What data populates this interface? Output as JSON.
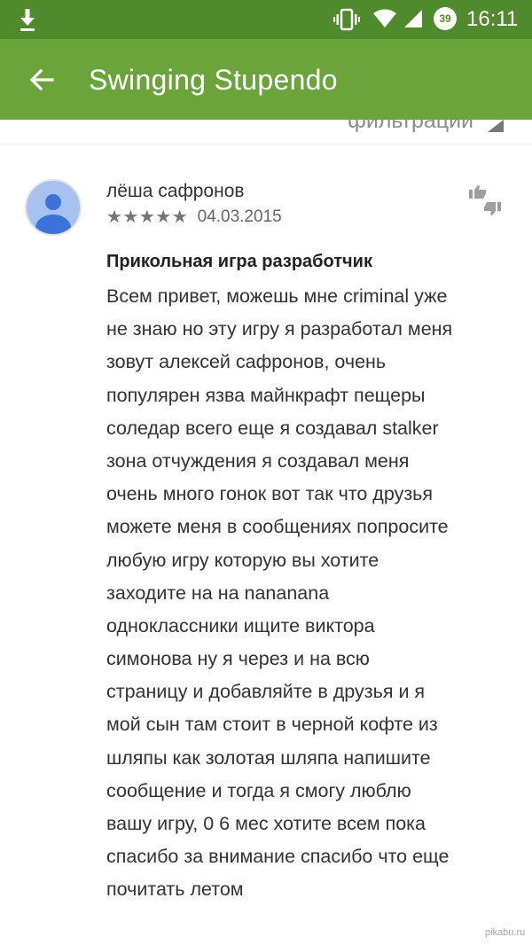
{
  "status_bar": {
    "time": "16:11",
    "battery_level": "39",
    "icons": [
      "download-icon",
      "vibrate-icon",
      "wifi-icon",
      "signal-icon",
      "battery-icon"
    ]
  },
  "app_bar": {
    "title": "Swinging Stupendo",
    "back_icon": "arrow-back-icon",
    "color": "#6ca43c",
    "status_color": "#4f8a2c"
  },
  "filter": {
    "label": "фильтрации"
  },
  "review": {
    "author": "лёша сафронов",
    "rating": 5,
    "stars": "★★★★★",
    "date": "04.03.2015",
    "title": "Прикольная игра разработчик",
    "body_lines": [
      "Всем привет, можешь мне criminal уже",
      "не знаю но эту игру я разработал меня",
      "зовут алексей сафронов, очень",
      "популярен язва майнкрафт пещеры",
      "соледар всего еще я создавал stalker",
      "зона отчуждения я создавал меня",
      "очень много гонок вот так что друзья",
      "можете меня в сообщениях попросите",
      "любую игру которую вы хотите",
      "заходите на на nananana",
      "одноклассники ищите виктора",
      "симонова ну я через и на всю",
      "страницу и добавляйте в друзья и я",
      "мой сын там стоит в черной кофте из",
      "шляпы как золотая шляпа напишите",
      "сообщение и тогда я смогу люблю",
      "вашу игру, 0 6 мес хотите всем пока",
      "спасибо за внимание спасибо что еще",
      "почитать летом"
    ]
  },
  "watermark": "pikabu.ru"
}
